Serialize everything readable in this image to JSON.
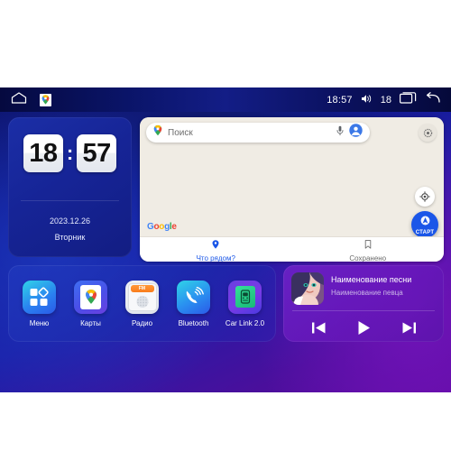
{
  "statusbar": {
    "home_icon": "home-icon",
    "maps_notification_icon": "google-maps-notification-icon",
    "time": "18:57",
    "volume_icon": "volume-icon",
    "volume_level": "18",
    "recents_icon": "recents-icon",
    "back_icon": "back-icon"
  },
  "clock_widget": {
    "hours": "18",
    "colon": ":",
    "minutes": "57",
    "date": "2023.12.26",
    "weekday": "Вторник"
  },
  "map_widget": {
    "search": {
      "placeholder": "Поиск",
      "pin_icon": "google-maps-pin-icon",
      "mic_icon": "microphone-icon",
      "account_icon": "account-avatar-icon"
    },
    "settings_icon": "gear-icon",
    "locate_icon": "compass-locate-icon",
    "start_button": {
      "label": "СТАРТ",
      "icon": "navigation-arrow-icon"
    },
    "attribution": "Google",
    "tabs": [
      {
        "label": "Что рядом?",
        "icon": "location-pin-icon",
        "active": true
      },
      {
        "label": "Сохранено",
        "icon": "bookmark-icon",
        "active": false
      }
    ]
  },
  "app_dock": {
    "apps": [
      {
        "label": "Меню",
        "icon": "grid-menu-icon"
      },
      {
        "label": "Карты",
        "icon": "maps-icon"
      },
      {
        "label": "Радио",
        "icon": "radio-icon",
        "band": "FM"
      },
      {
        "label": "Bluetooth",
        "icon": "bluetooth-phone-icon"
      },
      {
        "label": "Car Link 2.0",
        "icon": "car-link-icon"
      }
    ]
  },
  "music_widget": {
    "album_art_icon": "album-art-portrait",
    "track_title": "Наименование песни",
    "track_artist": "Наименование певца",
    "controls": [
      {
        "name": "previous-track-button",
        "icon": "skip-previous-icon"
      },
      {
        "name": "play-button",
        "icon": "play-icon"
      },
      {
        "name": "next-track-button",
        "icon": "skip-next-icon"
      }
    ]
  },
  "colors": {
    "accent_blue": "#1a56e8",
    "map_background": "#f0ece4",
    "music_purple": "#7823cd",
    "radio_orange": "#f97c1c"
  }
}
